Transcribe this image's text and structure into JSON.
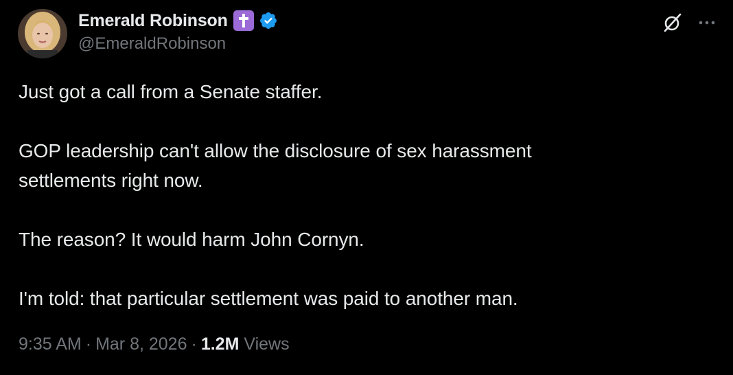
{
  "author": {
    "display_name": "Emerald Robinson",
    "handle": "@EmeraldRobinson",
    "badges": [
      "cross-emoji",
      "verified-checkmark"
    ],
    "badge_colors": {
      "cross": "#9b6ad6",
      "verified": "#1d9bf0"
    }
  },
  "actions": {
    "grok_icon": "grok-icon",
    "more_icon": "more-icon"
  },
  "tweet": {
    "paragraphs": [
      "Just got a call from a Senate staffer.",
      "GOP leadership can't allow the disclosure of sex harassment\nsettlements right now.",
      "The reason? It would harm John Cornyn.",
      "I'm told: that particular settlement was paid to another man."
    ]
  },
  "meta": {
    "time": "9:35 AM",
    "date": "Mar 8, 2026",
    "views_count": "1.2M",
    "views_label": "Views",
    "separator": "·"
  },
  "colors": {
    "background": "#000000",
    "primary_text": "#e7e9ea",
    "secondary_text": "#71767b"
  }
}
